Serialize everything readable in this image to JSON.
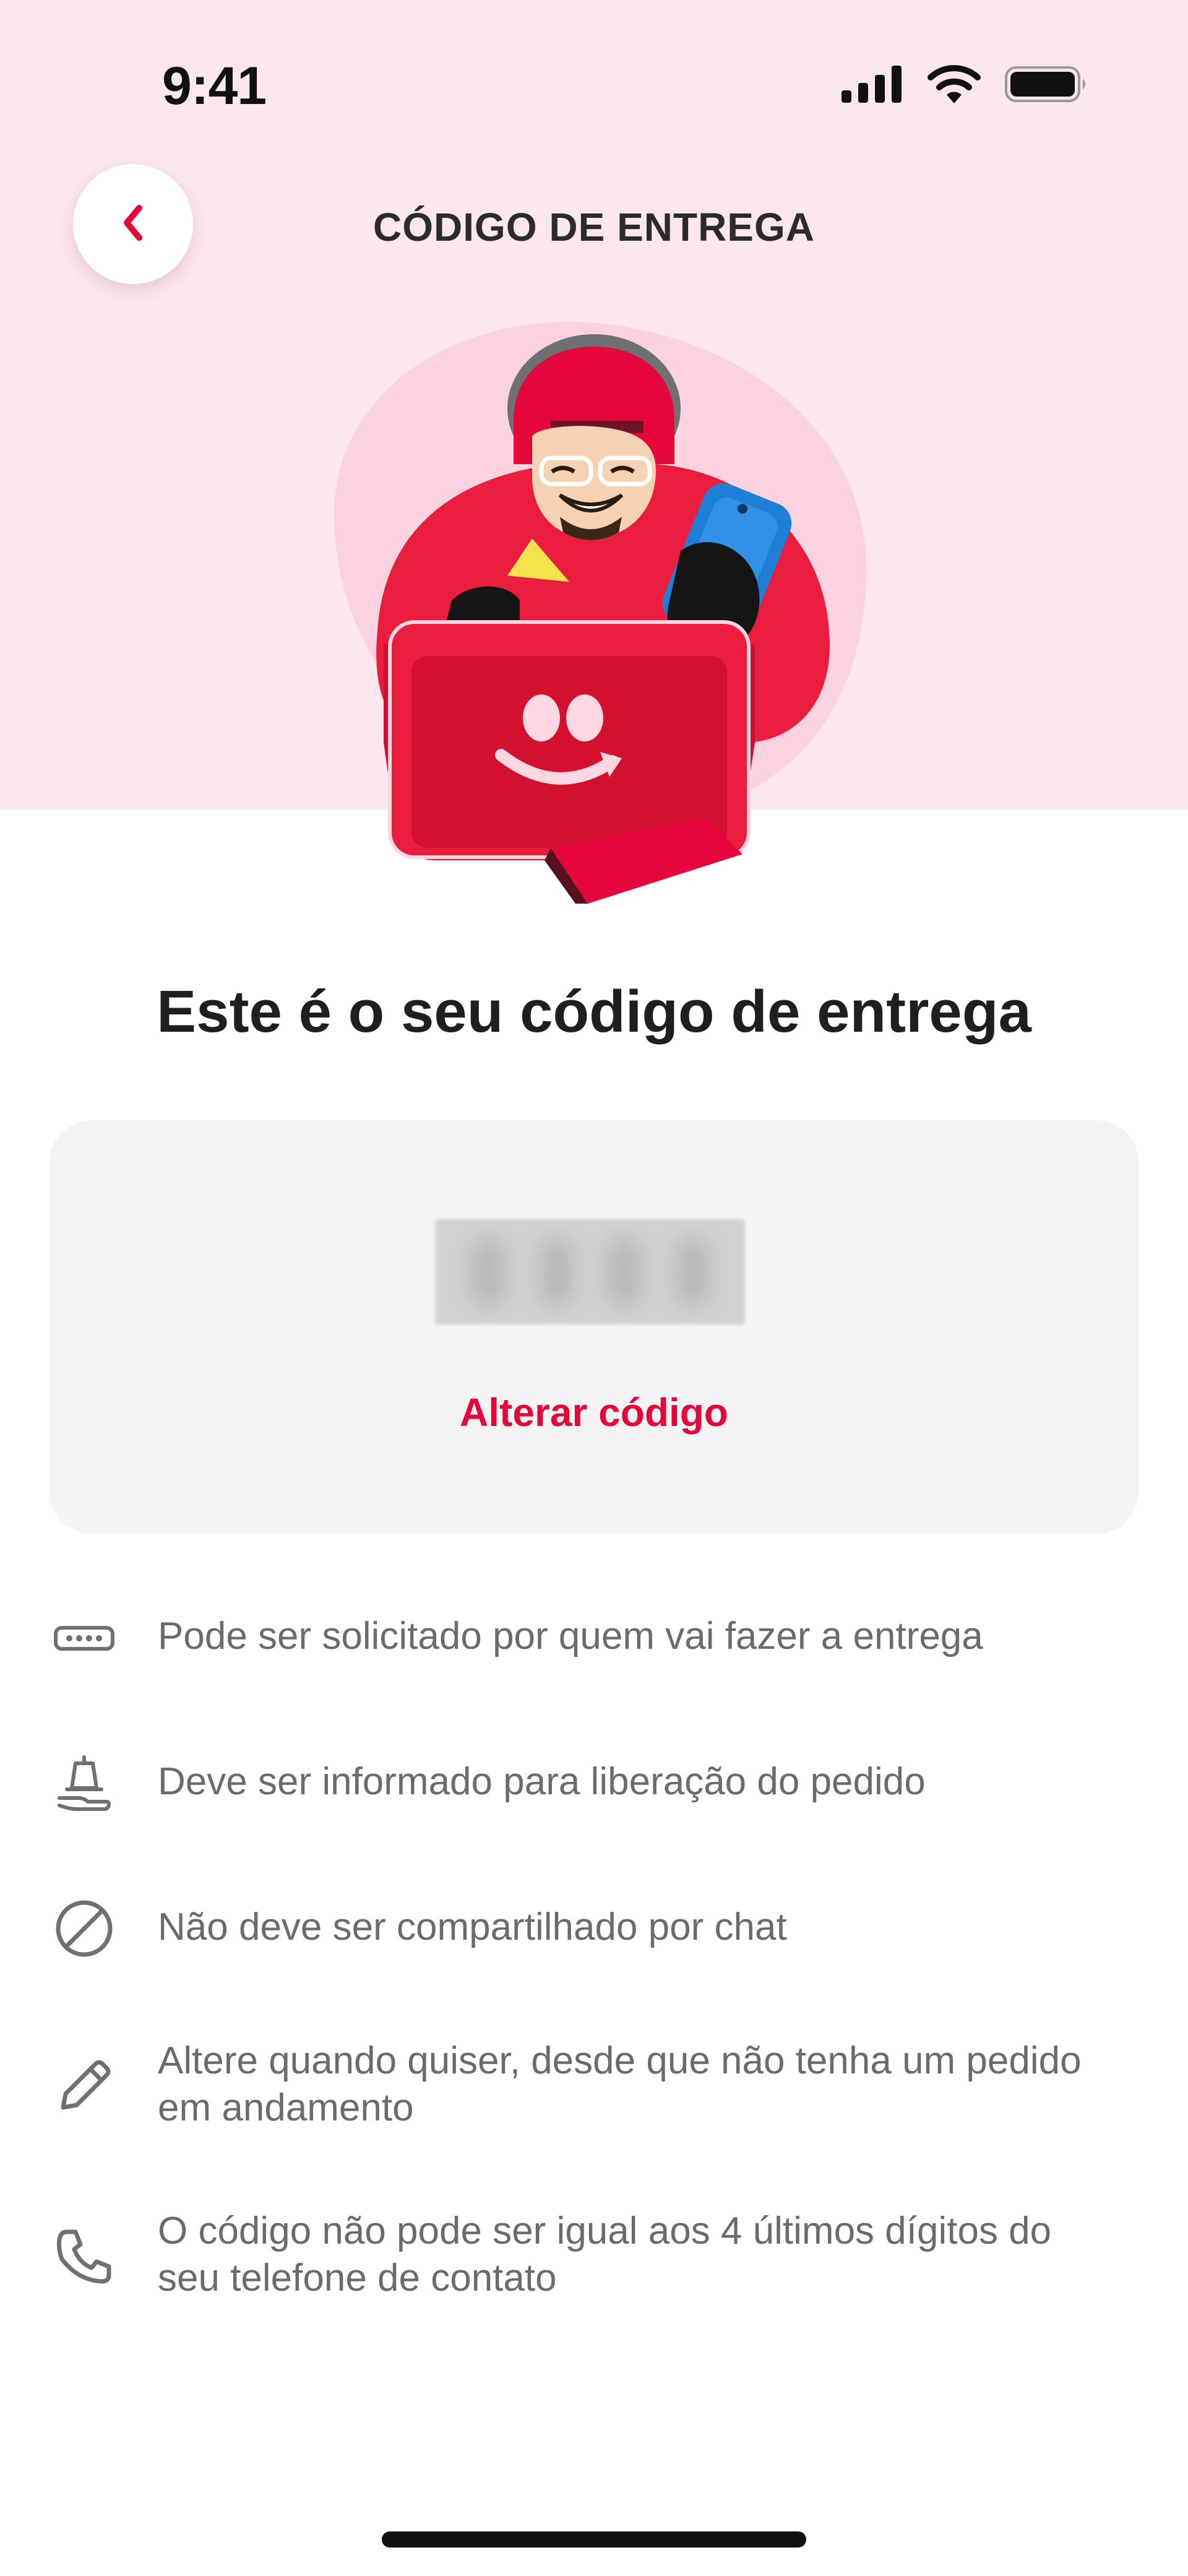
{
  "status_bar": {
    "time": "9:41",
    "icons": [
      "cellular-signal-icon",
      "wifi-icon",
      "battery-icon"
    ]
  },
  "nav": {
    "back_icon": "chevron-left-icon",
    "title": "CÓDIGO DE ENTREGA"
  },
  "illustration": {
    "name": "courier-with-phone-illustration"
  },
  "headline": "Este é o seu código de entrega",
  "code_card": {
    "code_hidden": true,
    "change_label": "Alterar código"
  },
  "info_items": [
    {
      "icon": "password-dots-icon",
      "text": "Pode ser solicitado por quem vai fazer a entrega"
    },
    {
      "icon": "hand-bell-icon",
      "text": "Deve ser informado para liberação do pedido"
    },
    {
      "icon": "prohibited-icon",
      "text": "Não deve ser compartilhado por chat"
    },
    {
      "icon": "pencil-icon",
      "text": "Altere quando quiser, desde que não tenha um pedido em andamento"
    },
    {
      "icon": "phone-icon",
      "text": "O código não pode ser igual aos 4 últimos dígitos do seu telefone de contato"
    }
  ],
  "colors": {
    "accent": "#e5063b",
    "hero_background": "#fde7ee",
    "card_background": "#f4f4f4",
    "text_primary": "#1f1f1f",
    "text_secondary": "#6b6b6b"
  }
}
